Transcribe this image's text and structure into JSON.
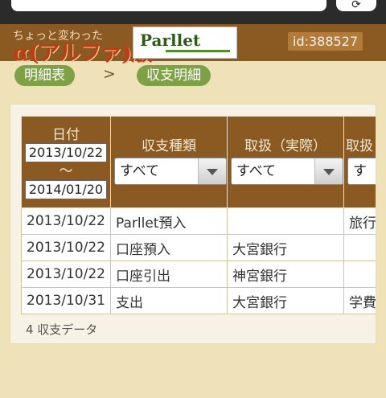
{
  "header": {
    "tagline": "ちょっと変わった",
    "logo_text": "α(アルファ)版",
    "partner_logo": "Parllet",
    "user_id": "id:388527"
  },
  "breadcrumb": {
    "items": [
      "明細表",
      "収支明細"
    ],
    "separator": ">"
  },
  "table": {
    "headers": {
      "date": "日付",
      "type": "収支種類",
      "handler": "取扱（実際）",
      "partial": "取扱"
    },
    "date_from": "2013/10/22",
    "range_mark": "〜",
    "date_to": "2014/01/20",
    "type_filter": "すべて",
    "handler_filter": "すべて",
    "partial_filter": "す",
    "rows": [
      {
        "date": "2013/10/22",
        "type": "Parllet預入",
        "handler": "",
        "extra": "旅行"
      },
      {
        "date": "2013/10/22",
        "type": "口座預入",
        "handler": "大宮銀行",
        "extra": ""
      },
      {
        "date": "2013/10/22",
        "type": "口座引出",
        "handler": "神宮銀行",
        "extra": ""
      },
      {
        "date": "2013/10/31",
        "type": "支出",
        "handler": "大宮銀行",
        "extra": "学費"
      }
    ],
    "count_text": "4 収支データ"
  }
}
